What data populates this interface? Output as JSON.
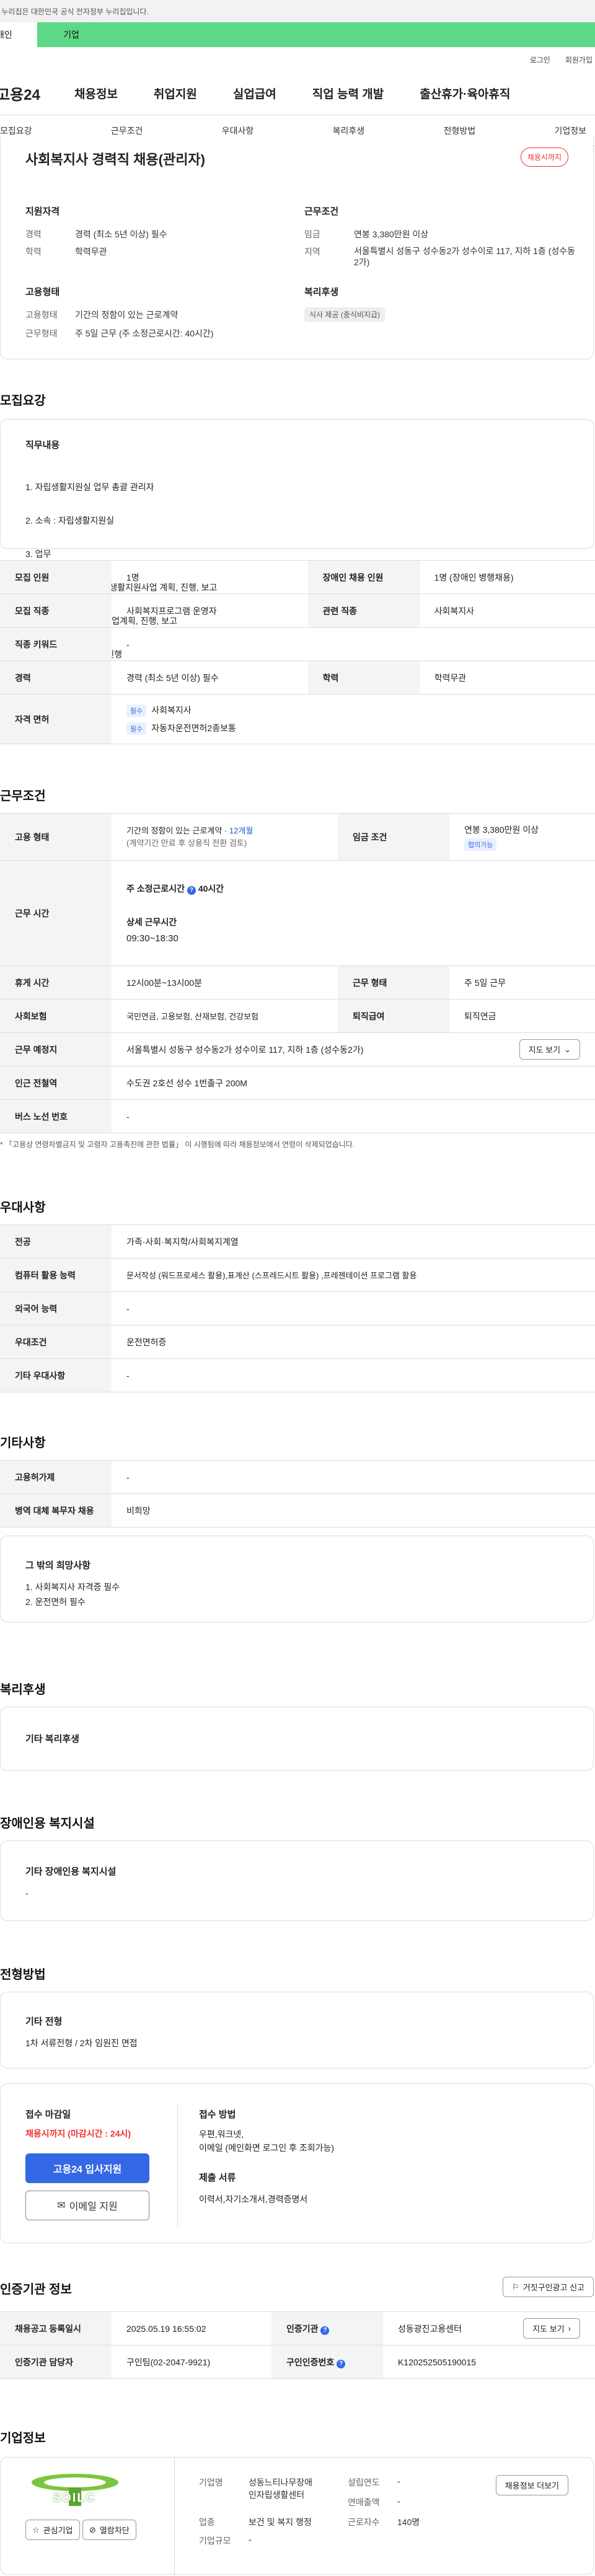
{
  "gov_bar": "이 누리집은 대한민국 공식 전자정부 누리집입니다.",
  "tabs": [
    "개인",
    "기업"
  ],
  "util": [
    "로그인",
    "회원가입"
  ],
  "logo": "고용24",
  "gnb": [
    "채용정보",
    "취업지원",
    "실업급여",
    "직업 능력 개발",
    "출산휴가·육아휴직"
  ],
  "anchor_nav": [
    "모집요강",
    "근무조건",
    "우대사항",
    "복리후생",
    "전형방법",
    "기업정보"
  ],
  "job": {
    "title": "사회복지사 경력직 채용(관리자)",
    "badge": "채용시까지",
    "qual_title": "지원자격",
    "cond_title": "근무조건",
    "type_title": "고용형태",
    "welfare_title": "복리후생",
    "career_k": "경력",
    "career_v": "경력 (최소 5년 이상) 필수",
    "edu_k": "학력",
    "edu_v": "학력무관",
    "wage_k": "임금",
    "wage_v": "연봉 3,380만원 이상",
    "loc_k": "지역",
    "loc_v": "서울특별시 성동구 성수동2가 성수이로 117, 지하 1층 (성수동2가)",
    "emp_k": "고용형태",
    "emp_v": "기간의 정함이 있는 근로계약",
    "work_k": "근무형태",
    "work_v": "주 5일 근무 (주 소정근로시간: 40시간)",
    "welfare_chip": "식사 제공 (중식비지급)"
  },
  "recruit": {
    "title": "모집요강",
    "duty_title": "직무내용",
    "duty_lines": [
      "1. 자립생활지원실 업무 총괄 관리자",
      "2. 소속 : 자립생활지원실",
      "3. 업무",
      "  가. 서울시 장애인자립생활지원사업 계획, 진행, 보고",
      "  나. 성동구 지원사업 사업계획, 진행, 보고",
      "  다. 기타 보조금 사업 진행"
    ],
    "rows": [
      {
        "k1": "모집 인원",
        "v1": "1명",
        "k2": "장애인 채용 인원",
        "v2": "1명 (장애인 병행채용)"
      },
      {
        "k1": "모집 직종",
        "v1": "사회복지프로그램 운영자",
        "k2": "관련 직종",
        "v2": "사회복지사"
      },
      {
        "k1": "직종 키워드",
        "v1": "-"
      },
      {
        "k1": "경력",
        "v1": "경력 (최소 5년 이상) 필수",
        "k2": "학력",
        "v2": "학력무관"
      }
    ],
    "license_k": "자격 면허",
    "req": "필수",
    "lic1": "사회복지사",
    "lic2": "자동차운전면허2종보통"
  },
  "cond": {
    "title": "근무조건",
    "emp_k": "고용 형태",
    "emp_v": "기간의 정함이 있는 근로계약 · ",
    "emp_month": "12개월",
    "emp_v2": "(계약기간 만료 후 상용직 전환 검토)",
    "wage_k": "임금 조건",
    "wage_v": "연봉 3,380만원 이상",
    "wage_chip": "협의가능",
    "time_k": "근무 시간",
    "std": "주 소정근로시간",
    "std_v": "40시간",
    "detail": "상세 근무시간",
    "detail_v": "09:30~18:30",
    "break_k": "휴게 시간",
    "break_v": "12시00분~13시00분",
    "wt_k": "근무 형태",
    "wt_v": "주 5일 근무",
    "ins_k": "사회보험",
    "ins_v": "국민연금, 고용보험, 산재보험, 건강보험",
    "ret_k": "퇴직급여",
    "ret_v": "퇴직연금",
    "place_k": "근무 예정지",
    "place_v": "서울특별시 성동구 성수동2가 성수이로 117, 지하 1층 (성수동2가)",
    "map": "지도 보기",
    "subway_k": "인근 전철역",
    "subway_v": "수도권 2호선 성수 1번출구 200M",
    "bus_k": "버스 노선 번호",
    "bus_v": "-",
    "note": "* 「고용상 연령차별금지 및 고령자 고용촉진에 관한 법률」 이 시행됨에 따라 채용정보에서 연령이 삭제되었습니다."
  },
  "pref": {
    "title": "우대사항",
    "rows": [
      {
        "k": "전공",
        "v": "가족·사회·복지학/사회복지계열"
      },
      {
        "k": "컴퓨터 활용 능력",
        "v": "문서작성 (워드프로세스 활용),표계산 (스프레드시트 활용) ,프레젠테이션 프로그램 활용"
      },
      {
        "k": "외국어 능력",
        "v": "-"
      },
      {
        "k": "우대조건",
        "v": "운전면허증"
      },
      {
        "k": "기타 우대사항",
        "v": "-"
      }
    ]
  },
  "etc": {
    "title": "기타사항",
    "rows": [
      {
        "k": "고용허가제",
        "v": "-"
      },
      {
        "k": "병역 대체 복무자 채용",
        "v": "비희망"
      }
    ],
    "wish_title": "그 밖의 희망사항",
    "wish_lines": [
      "1. 사회복지사 자격증 필수",
      "2. 운전면허 필수"
    ]
  },
  "welfare": {
    "title": "복리후생",
    "box": "기타 복리후생"
  },
  "facility": {
    "title": "장애인용 복지시설",
    "box": "기타 장애인용 복지시설",
    "val": "-"
  },
  "screen": {
    "title": "전형방법",
    "box": "기타 전형",
    "val": "1차 서류전형 / 2차 임원진 면접"
  },
  "apply": {
    "deadline_t": "접수 마감일",
    "deadline": "채용시까지 (마감시간 : 24시)",
    "btn": "고용24 입사지원",
    "email_btn": "이메일 지원",
    "method_t": "접수 방법",
    "method1": "우편,워크넷,",
    "method2": "이메일 (메인화면 로그인 후 조회가능)",
    "docs_t": "제출 서류",
    "docs": "이력서,자기소개서,경력증명서"
  },
  "cert": {
    "title": "인증기관 정보",
    "report": "거짓구인광고 신고",
    "rows": [
      {
        "k1": "채용공고 등록일시",
        "v1": "2025.05.19 16:55:02",
        "k2": "인증기관",
        "v2": "성동광진고용센터"
      },
      {
        "k1": "인증기관 담당자",
        "v1": "구인팀(02-2047-9921)",
        "k2": "구인인증번호",
        "v2": "K120252505190015"
      }
    ],
    "map": "지도 보기"
  },
  "company": {
    "title": "기업정보",
    "logo_text": "SDILC",
    "fav": "관심기업",
    "block": "열람차단",
    "name_k": "기업명",
    "name_v1": "성동느티나무장애",
    "name_v2": "인자립생활센터",
    "ind_k": "업종",
    "ind_v1": "보건 및 복지 행정",
    "ind_v2": "-",
    "size_k": "기업규모",
    "size_v": "-",
    "year_k": "설립연도",
    "year_v": "-",
    "sales_k": "연매출액",
    "sales_v": "-",
    "emp_k": "근로자수",
    "emp_v": "140명",
    "btn": "채용정보 더보기"
  }
}
